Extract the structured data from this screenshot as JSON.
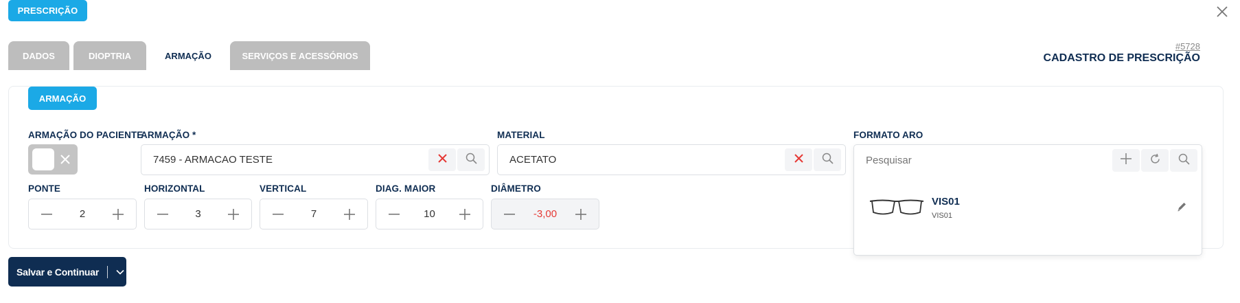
{
  "header": {
    "prescricao_label": "PRESCRIÇÃO",
    "order_number": "#5728",
    "title": "CADASTRO DE PRESCRIÇÃO"
  },
  "tabs": [
    {
      "label": "DADOS",
      "active": false
    },
    {
      "label": "DIOPTRIA",
      "active": false
    },
    {
      "label": "ARMAÇÃO",
      "active": true
    },
    {
      "label": "SERVIÇOS E ACESSÓRIOS",
      "active": false
    }
  ],
  "section": {
    "badge": "ARMAÇÃO",
    "patient_frame": {
      "label": "ARMAÇÃO DO PACIENTE",
      "checked": false
    },
    "frame": {
      "label": "ARMAÇÃO *",
      "value": "7459 - ARMACAO TESTE"
    },
    "material": {
      "label": "MATERIAL",
      "value": "ACETATO"
    },
    "rim_shape": {
      "label": "FORMATO ARO",
      "placeholder": "Pesquisar",
      "options": [
        {
          "name": "VIS01",
          "code": "VIS01"
        }
      ]
    },
    "steppers": [
      {
        "label": "PONTE",
        "value": "2",
        "disabled": false
      },
      {
        "label": "HORIZONTAL",
        "value": "3",
        "disabled": false
      },
      {
        "label": "VERTICAL",
        "value": "7",
        "disabled": false
      },
      {
        "label": "DIAG. MAIOR",
        "value": "10",
        "disabled": false
      },
      {
        "label": "DIÂMETRO",
        "value": "-3,00",
        "disabled": true
      }
    ]
  },
  "footer": {
    "save_label": "Salvar e Continuar"
  },
  "colors": {
    "primary": "#1ba9e6",
    "navy": "#0f2d52",
    "tab_inactive": "#bdbdbd",
    "danger": "#e53935"
  }
}
